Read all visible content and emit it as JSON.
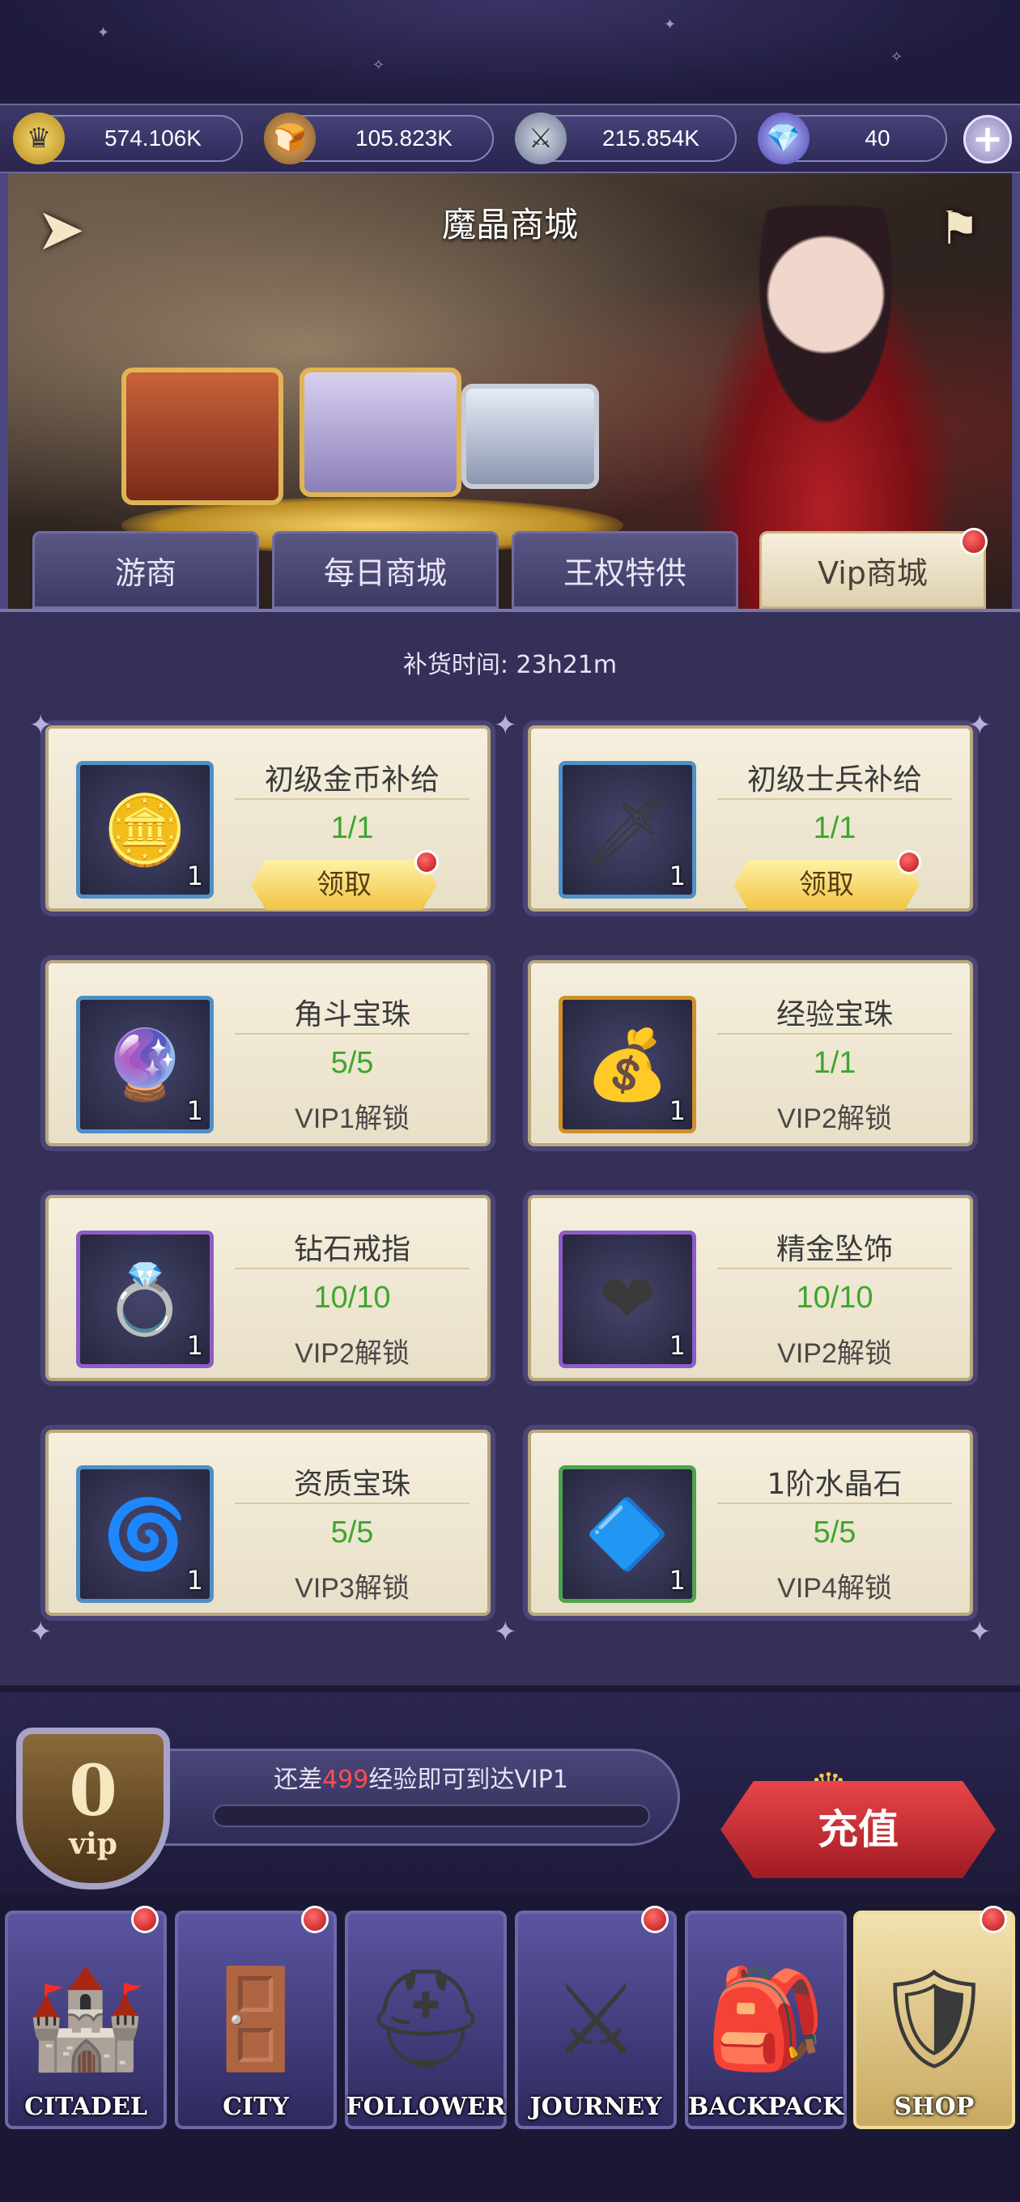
{
  "resources": [
    {
      "icon": "crown-coin-icon",
      "value": "574.106K"
    },
    {
      "icon": "bread-icon",
      "value": "105.823K"
    },
    {
      "icon": "weapons-icon",
      "value": "215.854K"
    },
    {
      "icon": "diamond-icon",
      "value": "40"
    }
  ],
  "banner": {
    "title": "魔晶商城"
  },
  "tabs": [
    {
      "label": "游商"
    },
    {
      "label": "每日商城"
    },
    {
      "label": "王权特供"
    },
    {
      "label": "Vip商城",
      "active": true
    }
  ],
  "restock": {
    "label": "补货时间:",
    "value": "23h21m"
  },
  "cards": [
    {
      "name": "初级金币补给",
      "count": "1/1",
      "qty": "1",
      "action": "领取",
      "icon": "gold-coins-icon"
    },
    {
      "name": "初级士兵补给",
      "count": "1/1",
      "qty": "1",
      "action": "领取",
      "icon": "sword-shield-icon"
    },
    {
      "name": "角斗宝珠",
      "count": "5/5",
      "qty": "1",
      "lock": "VIP1解锁",
      "icon": "crystal-orb-icon"
    },
    {
      "name": "经验宝珠",
      "count": "1/1",
      "qty": "1",
      "lock": "VIP2解锁",
      "icon": "gold-pile-icon"
    },
    {
      "name": "钻石戒指",
      "count": "10/10",
      "qty": "1",
      "lock": "VIP2解锁",
      "icon": "diamond-ring-icon"
    },
    {
      "name": "精金坠饰",
      "count": "10/10",
      "qty": "1",
      "lock": "VIP2解锁",
      "icon": "heart-pendant-icon"
    },
    {
      "name": "资质宝珠",
      "count": "5/5",
      "qty": "1",
      "lock": "VIP3解锁",
      "icon": "aptitude-orb-icon"
    },
    {
      "name": "1阶水晶石",
      "count": "5/5",
      "qty": "1",
      "lock": "VIP4解锁",
      "icon": "blue-crystal-icon"
    }
  ],
  "vip": {
    "level": "0",
    "level_text": "vip",
    "msg_prefix": "还差",
    "msg_value": "499",
    "msg_suffix": "经验即可到达VIP1",
    "progress": 0.0,
    "recharge_label": "充值"
  },
  "nav": [
    {
      "label": "CITADEL",
      "icon": "castle-icon",
      "badge": true
    },
    {
      "label": "CITY",
      "icon": "city-gate-icon",
      "badge": true
    },
    {
      "label": "FOLLOWER",
      "icon": "knight-helmet-icon",
      "badge": false
    },
    {
      "label": "JOURNEY",
      "icon": "crossed-swords-icon",
      "badge": true
    },
    {
      "label": "BACKPACK",
      "icon": "backpack-icon",
      "badge": false
    },
    {
      "label": "SHOP",
      "icon": "shop-icon",
      "badge": true,
      "active": true
    }
  ],
  "colors": {
    "accent_green": "#3ea62e",
    "badge_red": "#d92020",
    "highlight_red": "#ff4d4d",
    "panel": "#343058"
  }
}
